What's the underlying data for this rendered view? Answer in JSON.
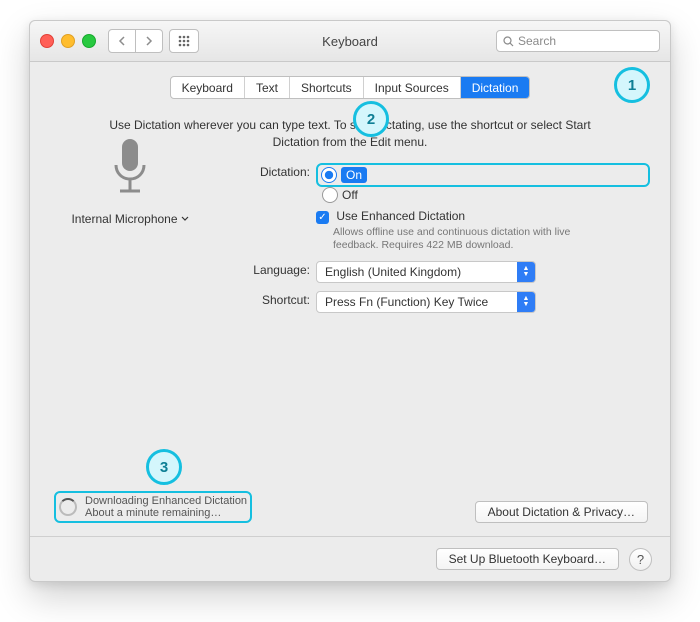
{
  "window": {
    "title": "Keyboard",
    "search_placeholder": "Search"
  },
  "tabs": {
    "t0": "Keyboard",
    "t1": "Text",
    "t2": "Shortcuts",
    "t3": "Input Sources",
    "t4": "Dictation"
  },
  "intro": "Use Dictation wherever you can type text. To start dictating, use the shortcut or select Start Dictation from the Edit menu.",
  "mic": {
    "label": "Internal Microphone"
  },
  "dictation": {
    "label": "Dictation:",
    "on": "On",
    "off": "Off",
    "enhanced_label": "Use Enhanced Dictation",
    "enhanced_sub": "Allows offline use and continuous dictation with live feedback. Requires 422 MB download."
  },
  "language": {
    "label": "Language:",
    "value": "English (United Kingdom)"
  },
  "shortcut": {
    "label": "Shortcut:",
    "value": "Press Fn (Function) Key Twice"
  },
  "download": {
    "line1": "Downloading Enhanced Dictation",
    "line2": "About a minute remaining…"
  },
  "buttons": {
    "about": "About Dictation & Privacy…",
    "bluetooth": "Set Up Bluetooth Keyboard…",
    "help": "?"
  },
  "callouts": {
    "c1": "1",
    "c2": "2",
    "c3": "3"
  }
}
